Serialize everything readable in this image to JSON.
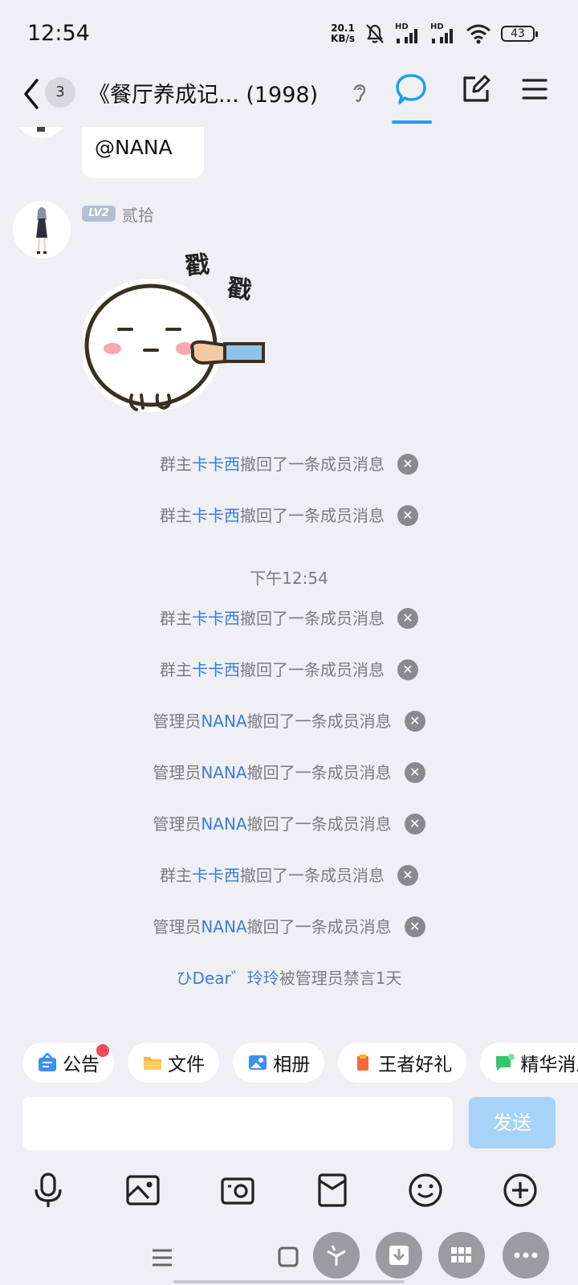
{
  "status_bar": {
    "time": "12:54",
    "net_speed_value": "20.1",
    "net_speed_unit": "KB/s",
    "signal1_label": "HD",
    "signal2_label": "HD",
    "battery": "43"
  },
  "header": {
    "unread_count": "3",
    "title": "《餐厅养成记...  (1998)"
  },
  "messages": {
    "partial_bubble_text": "@NANA",
    "sender": {
      "level": "LV2",
      "name": "贰拾"
    },
    "sticker_text": "戳戳",
    "system": [
      {
        "role": "群主",
        "name": "卡卡西",
        "action": "撤回了一条成员消息"
      },
      {
        "role": "群主",
        "name": "卡卡西",
        "action": "撤回了一条成员消息"
      }
    ],
    "timestamp": "下午12:54",
    "system2": [
      {
        "role": "群主",
        "name": "卡卡西",
        "action": "撤回了一条成员消息"
      },
      {
        "role": "群主",
        "name": "卡卡西",
        "action": "撤回了一条成员消息"
      },
      {
        "role": "管理员",
        "name": "NANA",
        "action": "撤回了一条成员消息"
      },
      {
        "role": "管理员",
        "name": "NANA",
        "action": "撤回了一条成员消息"
      },
      {
        "role": "管理员",
        "name": "NANA",
        "action": "撤回了一条成员消息"
      },
      {
        "role": "群主",
        "name": "卡卡西",
        "action": "撤回了一条成员消息"
      },
      {
        "role": "管理员",
        "name": "NANA",
        "action": "撤回了一条成员消息"
      }
    ],
    "ban": {
      "name": "ひDear゛玲玲",
      "action": "被管理员禁言1天"
    }
  },
  "quick_bar": [
    {
      "label": "公告",
      "icon": "announcement-icon",
      "color": "#3d8ff0"
    },
    {
      "label": "文件",
      "icon": "folder-icon",
      "color": "#f5b942"
    },
    {
      "label": "相册",
      "icon": "photo-album-icon",
      "color": "#3d8ff0"
    },
    {
      "label": "王者好礼",
      "icon": "gift-icon",
      "color": "#f26b3a"
    },
    {
      "label": "精华消息",
      "icon": "essence-icon",
      "color": "#38c46a"
    }
  ],
  "input": {
    "placeholder": "",
    "send_label": "发送"
  },
  "colors": {
    "highlight": "#3e7ed4",
    "accent": "#1fa0e8",
    "send_disabled": "#a6d3f7"
  }
}
